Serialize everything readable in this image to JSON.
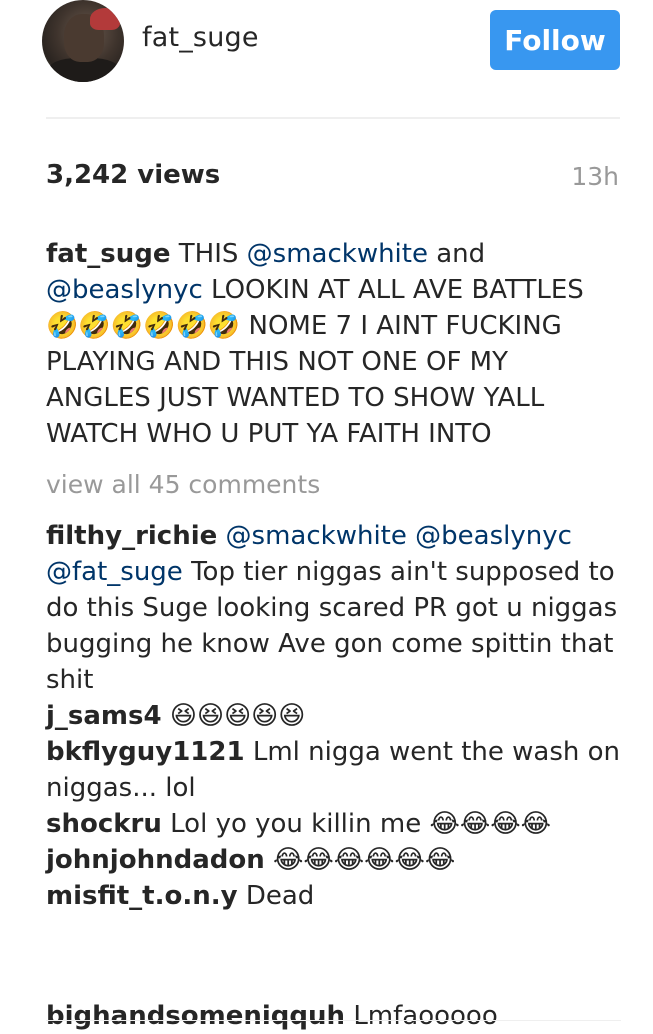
{
  "header": {
    "username": "fat_suge",
    "follow_label": "Follow"
  },
  "post": {
    "views": "3,242 views",
    "time_ago": "13h",
    "caption": {
      "username": "fat_suge",
      "text_1": "THIS",
      "mention_1": "@smackwhite",
      "text_2": "and",
      "mention_2": "@beaslynyc",
      "text_3": "LOOKIN AT ALL AVE BATTLES",
      "emojis": "🤣🤣🤣🤣🤣🤣",
      "text_4": "NOME 7 I AINT FUCKING PLAYING AND THIS NOT ONE OF MY ANGLES JUST WANTED TO SHOW YALL WATCH WHO U PUT YA FAITH INTO"
    },
    "view_all_comments": "view all 45 comments"
  },
  "comments": [
    {
      "username": "filthy_richie",
      "mention_1": "@smackwhite",
      "mention_2": "@beaslynyc",
      "mention_3": "@fat_suge",
      "text": "Top tier niggas ain't supposed to do this Suge looking scared PR got u niggas bugging he know Ave gon come spittin that shit"
    },
    {
      "username": "j_sams4",
      "emojis": "😆😆😆😆😆"
    },
    {
      "username": "bkflyguy1121",
      "text": "Lml nigga went the wash on niggas... lol"
    },
    {
      "username": "shockru",
      "text": "Lol yo you killin me",
      "emojis": "😂😂😂😂"
    },
    {
      "username": "johnjohndadon",
      "emojis": "😂😂😂😂😂😂"
    },
    {
      "username": "misfit_t.o.n.y",
      "text": "Dead"
    },
    {
      "username": "bighandsomeniqquh",
      "text": "Lmfaooooo"
    }
  ]
}
